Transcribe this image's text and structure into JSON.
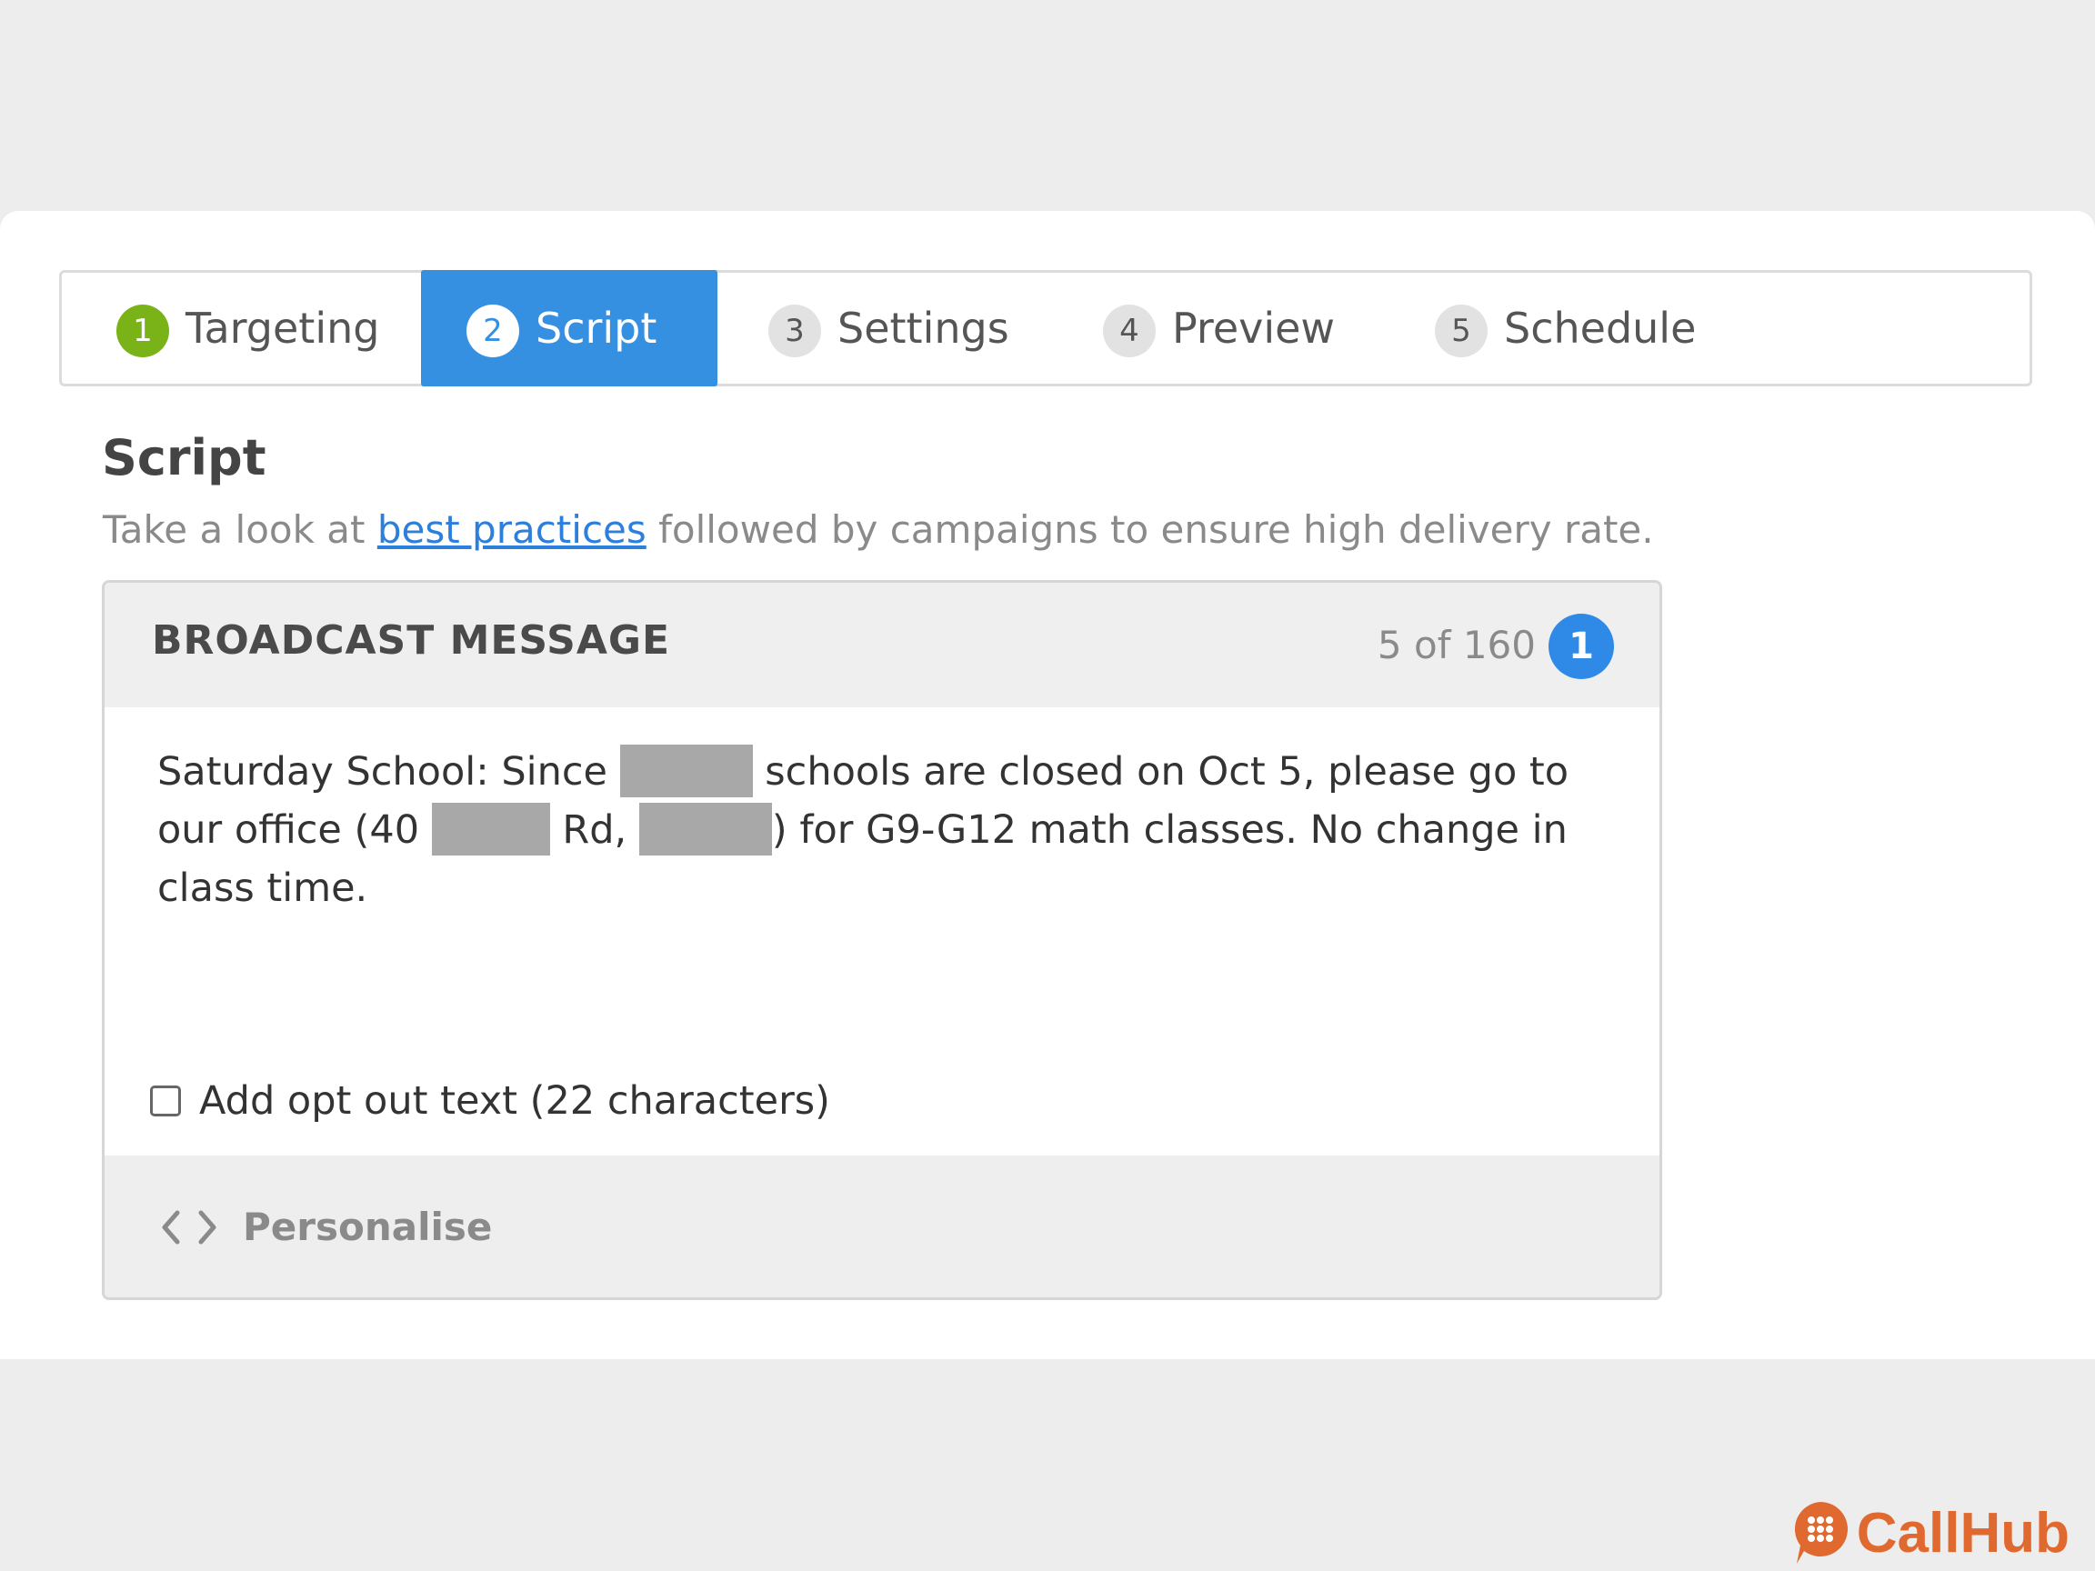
{
  "steps": [
    {
      "number": "1",
      "label": "Targeting",
      "state": "done"
    },
    {
      "number": "2",
      "label": "Script",
      "state": "active"
    },
    {
      "number": "3",
      "label": "Settings",
      "state": "pending"
    },
    {
      "number": "4",
      "label": "Preview",
      "state": "pending"
    },
    {
      "number": "5",
      "label": "Schedule",
      "state": "pending"
    }
  ],
  "script": {
    "title": "Script",
    "subtitle_before": "Take a look at ",
    "subtitle_link": "best practices",
    "subtitle_after": " followed by campaigns to ensure high delivery rate."
  },
  "message": {
    "header_label": "BROADCAST MESSAGE",
    "count_text": "5 of 160",
    "segment_badge": "1",
    "body_part1": "Saturday School: Since ",
    "body_part2": " schools are closed on Oct 5, please go to our office (40 ",
    "body_part3": " Rd, ",
    "body_part4": ") for G9-G12 math classes. No change in class time.",
    "optout_label": "Add opt out text (22 characters)",
    "optout_checked": false,
    "personalise_label": "Personalise"
  },
  "brand": {
    "name": "CallHub"
  },
  "colors": {
    "accent": "#3690e2",
    "done_step": "#7ab317",
    "badge": "#2e8ae6",
    "brand": "#e0692f",
    "link": "#2d7fdc"
  }
}
